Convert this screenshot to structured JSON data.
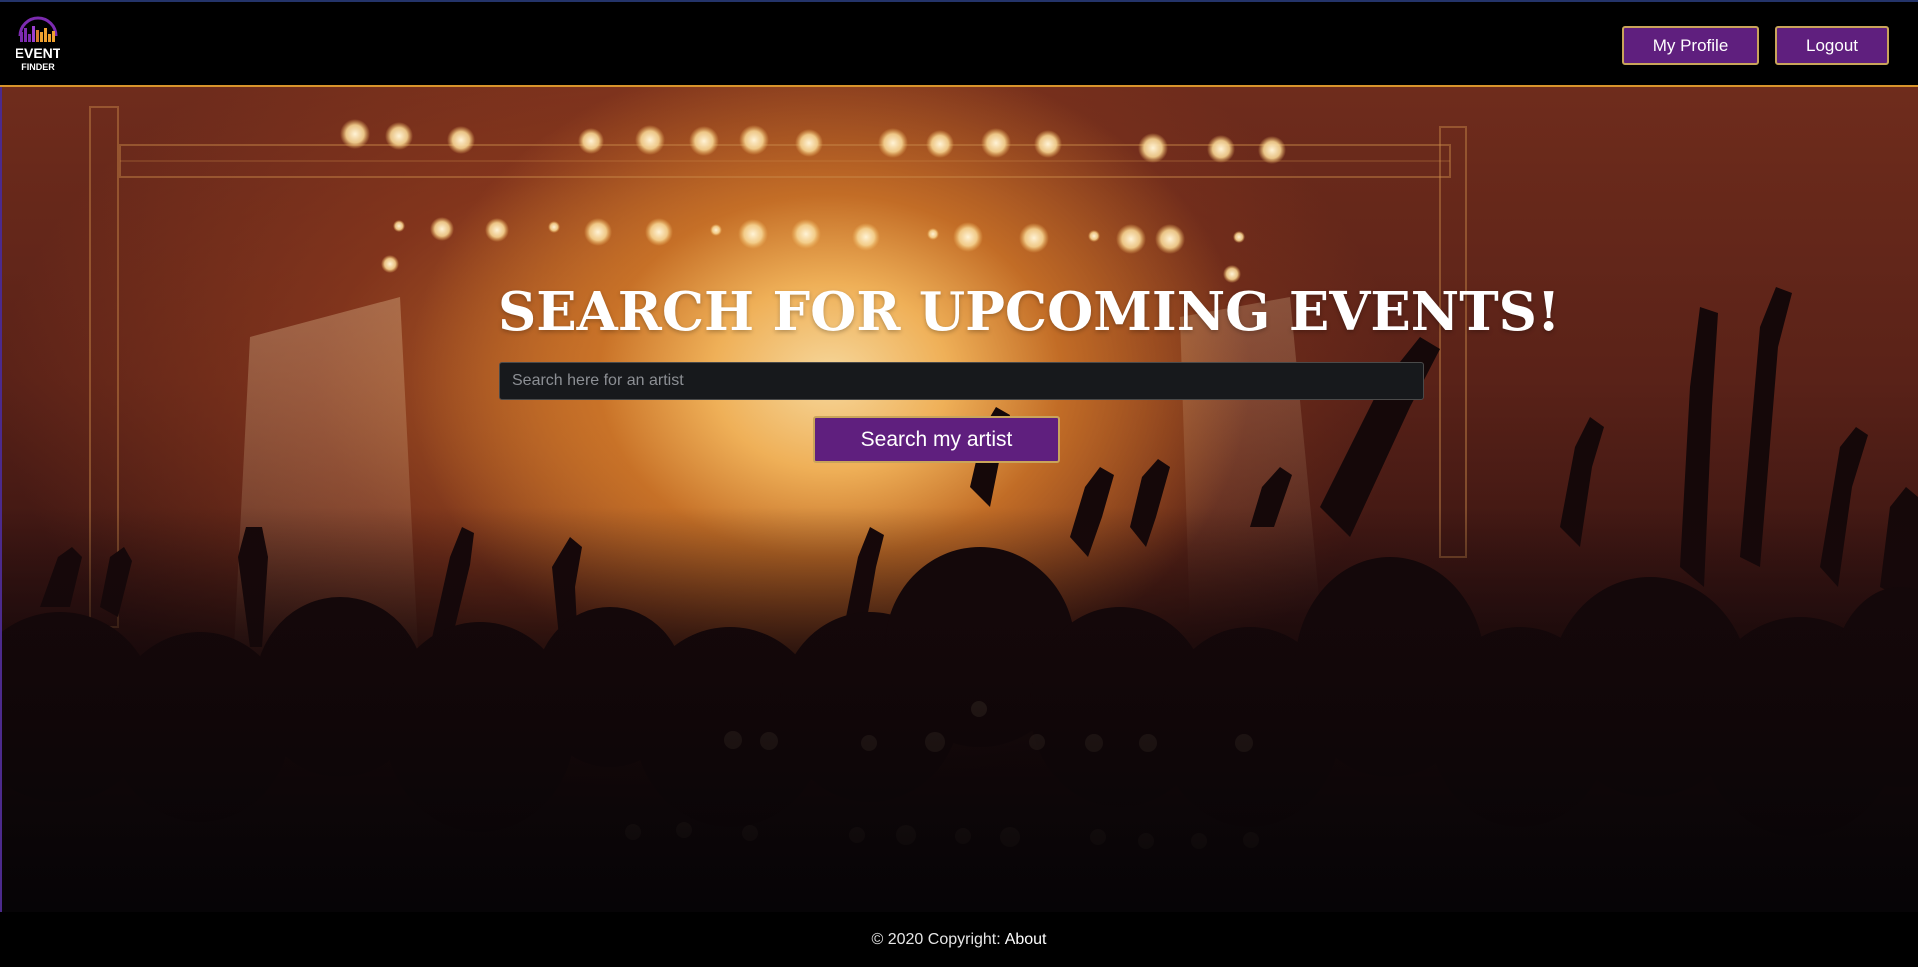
{
  "app": {
    "logo": {
      "line1": "EVENT",
      "line2": "FINDER",
      "accent_purple": "#7c2bb0",
      "accent_orange": "#f0a22f"
    }
  },
  "header": {
    "profile_label": "My Profile",
    "logout_label": "Logout"
  },
  "hero": {
    "title": "SEARCH FOR UPCOMING EVENTS!",
    "search_placeholder": "Search here for an artist",
    "search_value": "",
    "search_button_label": "Search my artist"
  },
  "footer": {
    "copyright": "© 2020 Copyright:",
    "about_label": "About"
  },
  "colors": {
    "brand_purple": "#5f1f7e",
    "button_border": "#c9a45a",
    "header_border": "#d8942c"
  }
}
